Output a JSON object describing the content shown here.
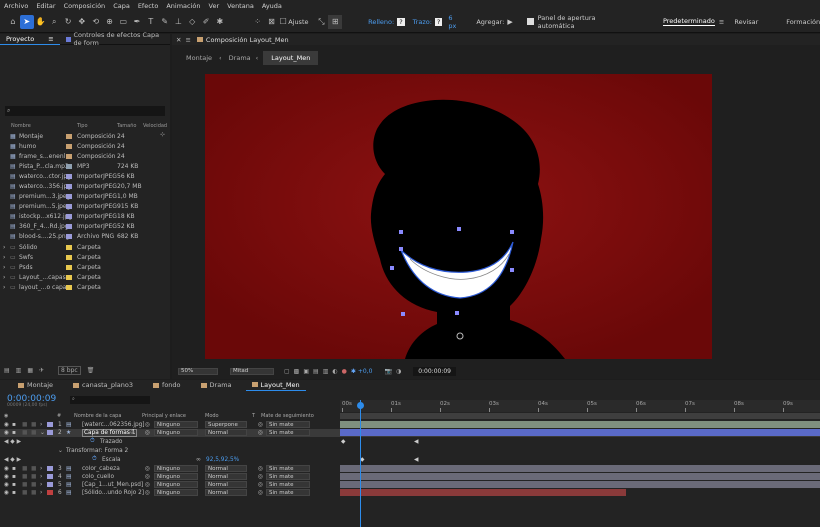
{
  "menu": [
    "Archivo",
    "Editar",
    "Composición",
    "Capa",
    "Efecto",
    "Animación",
    "Ver",
    "Ventana",
    "Ayuda"
  ],
  "toolbar": {
    "ajuste": "Ajuste",
    "relleno": "Relleno:",
    "relleno_val": "?",
    "trazo": "Trazo:",
    "trazo_val": "?",
    "trazo_px": "6 px",
    "agregar": "Agregar:",
    "panel_label": "Panel de apertura automática",
    "workspace_active": "Predeterminado",
    "workspace_2": "Revisar",
    "workspace_3": "Formación"
  },
  "project": {
    "tab1": "Proyecto",
    "tab2": "Controles de efectos Capa de form",
    "search_placeholder": "",
    "headers": {
      "name": "Nombre",
      "type": "Tipo",
      "size": "Tamaño",
      "speed": "Velocidad"
    },
    "items": [
      {
        "name": "Montaje",
        "type": "Composición",
        "size": "24",
        "color": "#c8a070",
        "kind": "comp"
      },
      {
        "name": "humo",
        "type": "Composición",
        "size": "24",
        "color": "#c8a070",
        "kind": "comp"
      },
      {
        "name": "frame_s...enenl",
        "type": "Composición",
        "size": "24",
        "color": "#c8a070",
        "kind": "comp"
      },
      {
        "name": "Pista_P...cla.mp3",
        "type": "MP3",
        "size": "724 KB",
        "color": "#8fa0b0",
        "kind": "file"
      },
      {
        "name": "waterco...ctor.jpg",
        "type": "ImporterJPEG",
        "size": "56 KB",
        "color": "#9a9ad8",
        "kind": "file"
      },
      {
        "name": "waterco...356.jpg",
        "type": "ImporterJPEG",
        "size": "20,7 MB",
        "color": "#9a9ad8",
        "kind": "file"
      },
      {
        "name": "premium...3.jpeg",
        "type": "ImporterJPEG",
        "size": "1,0 MB",
        "color": "#9a9ad8",
        "kind": "file"
      },
      {
        "name": "premium...5.jpeg",
        "type": "ImporterJPEG",
        "size": "915 KB",
        "color": "#9a9ad8",
        "kind": "file"
      },
      {
        "name": "istockp...x612.jpg",
        "type": "ImporterJPEG",
        "size": "18 KB",
        "color": "#9a9ad8",
        "kind": "file"
      },
      {
        "name": "360_F_4...Rd.jpg",
        "type": "ImporterJPEG",
        "size": "52 KB",
        "color": "#9a9ad8",
        "kind": "file"
      },
      {
        "name": "blood-s....25.png",
        "type": "Archivo PNG",
        "size": "682 KB",
        "color": "#9a9ad8",
        "kind": "file"
      },
      {
        "name": "Sólido",
        "type": "Carpeta",
        "size": "",
        "color": "#e8c850",
        "kind": "folder"
      },
      {
        "name": "Swfs",
        "type": "Carpeta",
        "size": "",
        "color": "#e8c850",
        "kind": "folder"
      },
      {
        "name": "Psds",
        "type": "Carpeta",
        "size": "",
        "color": "#e8c850",
        "kind": "folder"
      },
      {
        "name": "Layout_...capas",
        "type": "Carpeta",
        "size": "",
        "color": "#e8c850",
        "kind": "folder"
      },
      {
        "name": "layout_...o capas",
        "type": "Carpeta",
        "size": "",
        "color": "#e8c850",
        "kind": "folder"
      }
    ],
    "bpc": "8 bpc"
  },
  "comp": {
    "tab": "Composición Layout_Men",
    "crumbs": [
      "Montaje",
      "Drama",
      "Layout_Men"
    ],
    "zoom": "50%",
    "quality": "Mitad",
    "exposure": "+0,0",
    "timecode": "0:00:00:09"
  },
  "timeline": {
    "tabs": [
      "Montaje",
      "canasta_plano3",
      "fondo",
      "Drama",
      "Layout_Men"
    ],
    "timecode": "0:00:00:09",
    "fps": "00009 (24,00 fps)",
    "headers": {
      "num": "#",
      "name": "Nombre de la capa",
      "parent": "Principal y enlace",
      "mode": "Modo",
      "t": "T",
      "matte": "Mate de seguimiento"
    },
    "ruler": [
      "00s",
      "01s",
      "02s",
      "03s",
      "04s",
      "05s",
      "06s",
      "07s",
      "08s",
      "09s"
    ],
    "layers": [
      {
        "num": "1",
        "name": "[waterc...062356.jpg]",
        "parent": "Ninguno",
        "mode": "Superpone",
        "matte": "Sin mate",
        "color": "#9a9ad8"
      },
      {
        "num": "2",
        "name": "Capa de formas 1",
        "parent": "Ninguno",
        "mode": "Normal",
        "matte": "Sin mate",
        "color": "#9a9ad8"
      },
      {
        "num": "3",
        "name": "color_cabeza",
        "parent": "Ninguno",
        "mode": "Normal",
        "matte": "Sin mate",
        "color": "#9a9ad8"
      },
      {
        "num": "4",
        "name": "colo_cuello",
        "parent": "Ninguno",
        "mode": "Normal",
        "matte": "Sin mate",
        "color": "#9a9ad8"
      },
      {
        "num": "5",
        "name": "[Cap_1...ut_Men.psd]",
        "parent": "Ninguno",
        "mode": "Normal",
        "matte": "Sin mate",
        "color": "#9a9ad8"
      },
      {
        "num": "6",
        "name": "[Sólido...undo Rojo 2]",
        "parent": "Ninguno",
        "mode": "Normal",
        "matte": "Sin mate",
        "color": "#c04040"
      }
    ],
    "sub": {
      "trazado": "Trazado",
      "transformar": "Transformar: Forma 2",
      "escala": "Escala",
      "escala_val": "92,5,92,5%"
    }
  }
}
